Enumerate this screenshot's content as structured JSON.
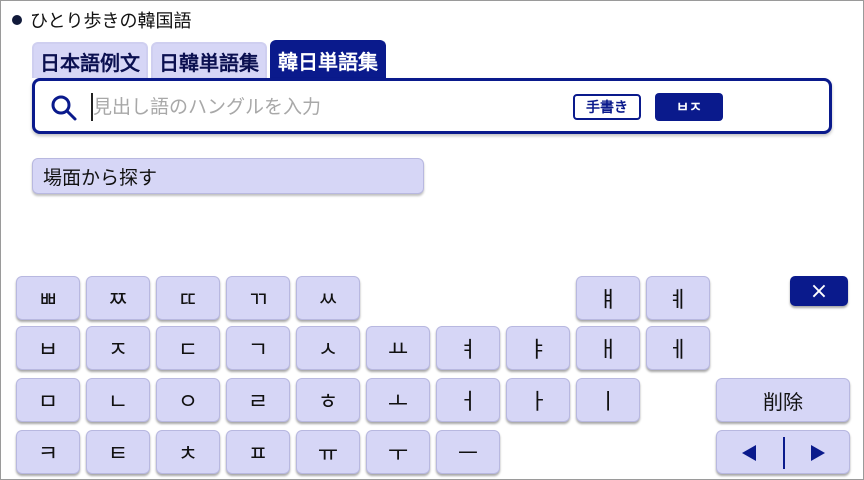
{
  "app": {
    "title": "ひとり歩きの韓国語"
  },
  "tabs": [
    {
      "label": "日本語例文",
      "active": false
    },
    {
      "label": "日韓単語集",
      "active": false
    },
    {
      "label": "韓日単語集",
      "active": true
    }
  ],
  "search": {
    "value": "",
    "placeholder": "見出し語のハングルを入力",
    "handwriting_label": "手書き",
    "hangul_label": "ㅂㅈ"
  },
  "scene_button": {
    "label": "場面から探す"
  },
  "keyboard": {
    "row1": [
      "ㅃ",
      "ㅉ",
      "ㄸ",
      "ㄲ",
      "ㅆ"
    ],
    "row1_vowels": [
      "ㅒ",
      "ㅖ"
    ],
    "row2": [
      "ㅂ",
      "ㅈ",
      "ㄷ",
      "ㄱ",
      "ㅅ",
      "ㅛ",
      "ㅕ",
      "ㅑ",
      "ㅐ",
      "ㅔ"
    ],
    "row3": [
      "ㅁ",
      "ㄴ",
      "ㅇ",
      "ㄹ",
      "ㅎ",
      "ㅗ",
      "ㅓ",
      "ㅏ",
      "ㅣ"
    ],
    "row4": [
      "ㅋ",
      "ㅌ",
      "ㅊ",
      "ㅍ",
      "ㅠ",
      "ㅜ",
      "ㅡ"
    ],
    "close_label": "×",
    "delete_label": "削除"
  },
  "colors": {
    "accent": "#0a1a8c",
    "key_bg": "#d6d6f6"
  },
  "icons": {
    "search": "search-icon",
    "close": "close-icon",
    "left": "arrow-left-icon",
    "right": "arrow-right-icon"
  }
}
